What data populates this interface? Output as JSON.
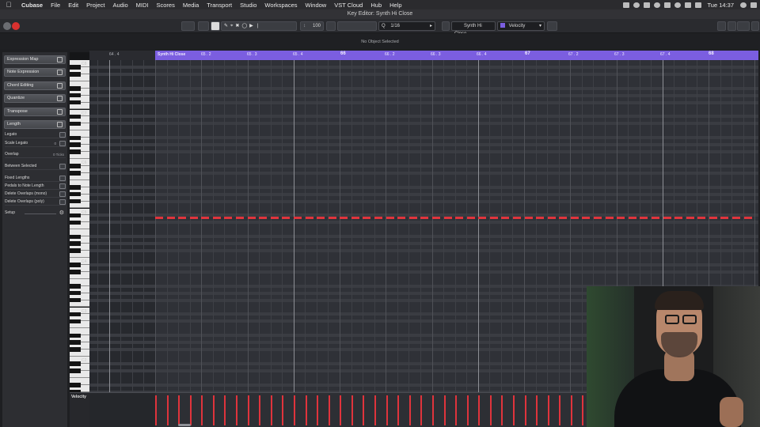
{
  "menubar": {
    "app_name": "Cubase",
    "items": [
      "File",
      "Edit",
      "Project",
      "Audio",
      "MIDI",
      "Scores",
      "Media",
      "Transport",
      "Studio",
      "Workspaces",
      "Window",
      "VST Cloud",
      "Hub",
      "Help"
    ],
    "clock": "Tue 14:37"
  },
  "window": {
    "title": "Key Editor: Synth Hi Close"
  },
  "toolbar": {
    "nudge_value": "100",
    "quantize": "1/16",
    "part_name": "Synth Hi Close",
    "controller": "Velocity"
  },
  "infoline": {
    "text": "No Object Selected"
  },
  "inspector": {
    "sections": [
      "Expression Map",
      "Note Expression",
      "Chord Editing",
      "Quantize",
      "Transpose",
      "Length"
    ],
    "length_rows": [
      {
        "label": "Legato",
        "value": ""
      },
      {
        "label": "Scale Legato",
        "value": "0"
      },
      {
        "label": "Overlap",
        "value": "0 Ticks"
      },
      {
        "label": "Between Selected",
        "value": ""
      }
    ],
    "functions": [
      "Fixed Lengths",
      "Pedals to Note Length",
      "Delete Overlaps (mono)",
      "Delete Overlaps (poly)"
    ],
    "setup": "Setup"
  },
  "keyboard": {
    "labels": [
      "C8",
      "C7",
      "C6",
      "C5",
      "C4",
      "C3",
      "C2"
    ]
  },
  "ruler": {
    "part_label": "Synth Hi Close",
    "pre_label": "64 . 4",
    "labels": [
      "65 . 2",
      "65 . 3",
      "65 . 4",
      "66",
      "66 . 2",
      "66 . 3",
      "66 . 4",
      "67",
      "67 . 2",
      "67 . 3",
      "67 . 4",
      "68"
    ]
  },
  "velocity_lane": {
    "label": "Velocity"
  },
  "notes": {
    "count": 52,
    "color": "#e0343c"
  },
  "colors": {
    "part": "#7b5ee0",
    "note": "#e0343c",
    "background": "#2f3137"
  }
}
